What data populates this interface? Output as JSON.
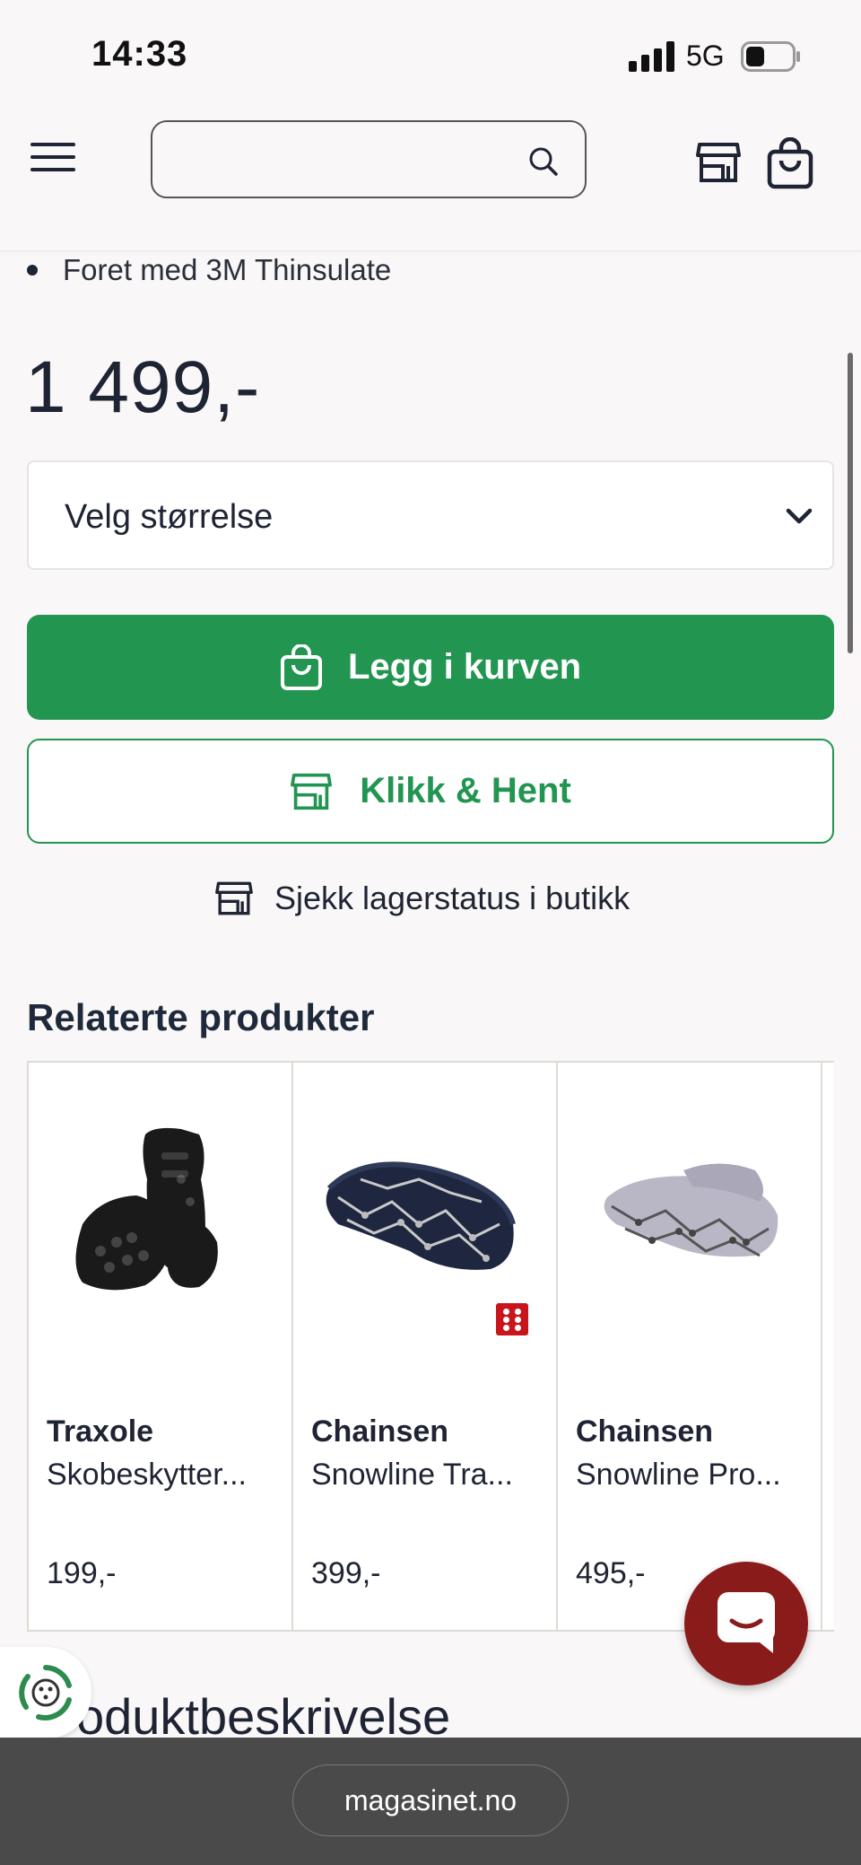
{
  "status_bar": {
    "time": "14:33",
    "network": "5G"
  },
  "header": {
    "search": {
      "value": "",
      "placeholder": ""
    }
  },
  "product": {
    "bullet": "Foret med 3M Thinsulate",
    "price": "1 499,-",
    "size_select_label": "Velg størrelse",
    "add_to_cart_label": "Legg i kurven",
    "click_collect_label": "Klikk & Hent",
    "stock_link_label": "Sjekk lagerstatus i butikk"
  },
  "related": {
    "title": "Relaterte produkter",
    "items": [
      {
        "brand": "Traxole",
        "name": "Skobeskytter...",
        "price": "199,-"
      },
      {
        "brand": "Chainsen",
        "name": "Snowline Tra...",
        "price": "399,-"
      },
      {
        "brand": "Chainsen",
        "name": "Snowline Pro...",
        "price": "495,-"
      }
    ]
  },
  "description_title": "oduktbeskrivelse",
  "browser": {
    "url": "magasinet.no"
  },
  "colors": {
    "primary_green": "#229551",
    "chat_red": "#8a1b1b",
    "badge_red": "#c8141b",
    "text_dark": "#1e2433"
  },
  "icons": [
    "menu-icon",
    "search-icon",
    "store-icon",
    "cart-icon",
    "bag-icon",
    "chevron-down-icon",
    "chat-icon",
    "eco-icon"
  ]
}
